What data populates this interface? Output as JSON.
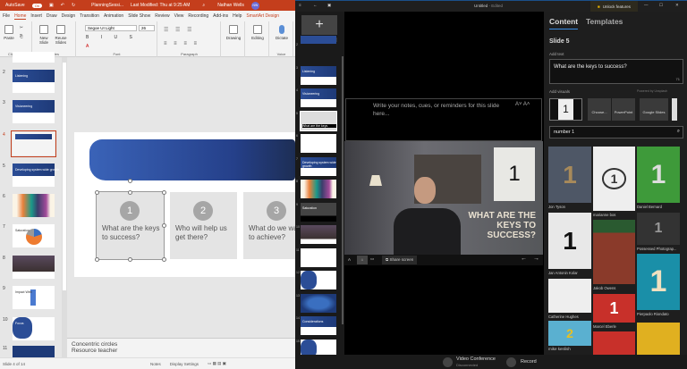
{
  "ppt": {
    "titlebar": {
      "autosave": "AutoSave",
      "toggle": "On",
      "filename": "PlanningSessi...",
      "modified": "Last Modified: Thu at 9:25 AM",
      "user": "Nathan Wells",
      "initials": "NW"
    },
    "tabs": [
      "File",
      "Home",
      "Insert",
      "Draw",
      "Design",
      "Transition",
      "Animation",
      "Slide Show",
      "Review",
      "View",
      "Recording",
      "Add-ins",
      "Help",
      "SmartArt Design"
    ],
    "ribbon": {
      "paste": "Paste",
      "new_slide": "New Slide",
      "reuse_slides": "Reuse Slides",
      "font": "Segoe UI Light",
      "size": "26",
      "drawing": "Drawing",
      "editing": "Editing",
      "dictate": "Dictate",
      "groups": {
        "clipboard": "Clipboard",
        "slides": "Slides",
        "font": "Font",
        "paragraph": "Paragraph",
        "voice": "Voice"
      }
    },
    "thumb_numbers": [
      "2",
      "3",
      "4",
      "5",
      "6",
      "7",
      "8",
      "9",
      "10",
      "11"
    ],
    "thumb_titles": [
      "Listening",
      "Visioneering",
      "",
      "Developing system wide growth",
      "",
      "Saturation",
      "",
      "Impact Web",
      "Focus",
      ""
    ],
    "slide": {
      "cards": [
        {
          "num": "1",
          "text": "What are the keys\nto success?"
        },
        {
          "num": "2",
          "text": "Who will help us\nget there?"
        },
        {
          "num": "3",
          "text": "What do we wa\nto achieve?"
        }
      ]
    },
    "notes": "Concentric circles",
    "notes2": "Resource teacher",
    "status": {
      "slide": "Slide 4 of 14",
      "notes": "Notes",
      "display": "Display Settings"
    }
  },
  "app": {
    "title": "Untitled",
    "edited": "- Edited",
    "unlock": "Unlock features",
    "thumb_numbers": [
      "2",
      "3",
      "4",
      "5",
      "6",
      "7",
      "8",
      "9",
      "10",
      "11",
      "12",
      "13",
      "14",
      "15"
    ],
    "thumb_titles": [
      "",
      "Listening",
      "Visioneering",
      "What are the keys",
      "",
      "Developing system wide growth",
      "",
      "Saturation",
      "",
      "",
      "",
      "",
      "Considerations",
      ""
    ],
    "notes_placeholder": "Write your notes, cues, or reminders for this slide here...",
    "video_slide": {
      "num": "1",
      "headline": "WHAT ARE THE\nKEYS TO\nSUCCESS?"
    },
    "controls": {
      "share": "Share screen"
    },
    "panel": {
      "tabs": [
        "Content",
        "Templates"
      ],
      "slide": "Slide 5",
      "add_text": "Add text",
      "text_value": "What are the keys to success?",
      "char_count": "71",
      "add_visuals": "Add visuals",
      "powered": "Powered by Unsplash",
      "visual_buttons": [
        "Choose...",
        "PowerPoint",
        "Google Slides"
      ],
      "search": "number 1",
      "images": [
        {
          "credit": "Jon Tyson"
        },
        {
          "credit": "marianne bos"
        },
        {
          "credit": "Daniel Bernard"
        },
        {
          "credit": "Jan Antonin Kolar"
        },
        {
          "credit": "Possessed Photograp..."
        },
        {
          "credit": "Jakob Owens"
        },
        {
          "credit": "Catherine Hughes"
        },
        {
          "credit": "Pierpaolo Riondato"
        },
        {
          "credit": "Marcel Eberle"
        },
        {
          "credit": "mike kenlish"
        }
      ]
    },
    "bottom": {
      "vc": "Video Conference",
      "vc_status": "Disconnected",
      "record": "Record"
    }
  }
}
